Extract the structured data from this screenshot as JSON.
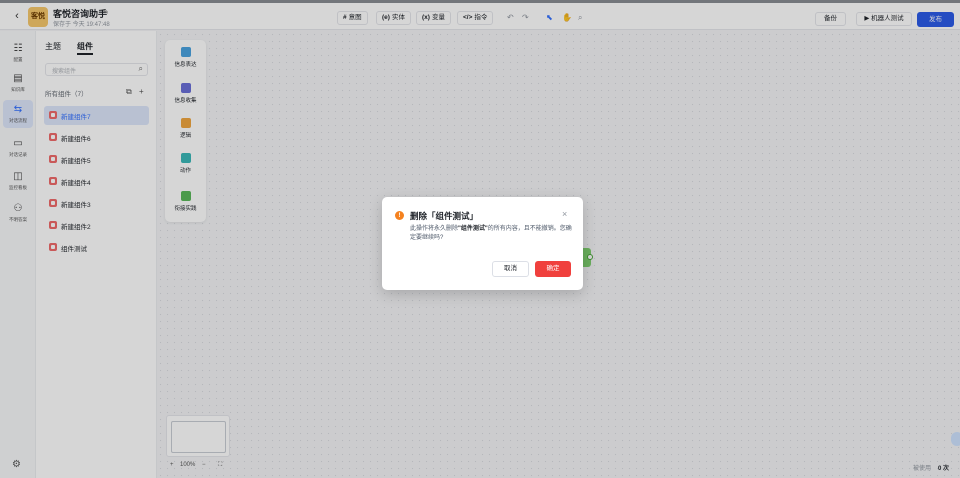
{
  "header": {
    "back_icon": "chevron-left-icon",
    "logo_text": "客悦",
    "title": "客悦咨询助手",
    "save_status": "保存于 今天 19:47:48",
    "tools": [
      {
        "icon": "#",
        "label": "意图"
      },
      {
        "icon": "(e)",
        "label": "实体"
      },
      {
        "icon": "(x)",
        "label": "变量"
      },
      {
        "icon": "</>",
        "label": "指令"
      }
    ],
    "backup_label": "备份",
    "robot_test_label": "▶ 机器人测试",
    "publish_label": "发布"
  },
  "nav": {
    "items": [
      {
        "icon": "☷",
        "label": "配置"
      },
      {
        "icon": "▤",
        "label": "知识库"
      },
      {
        "icon": "⇆",
        "label": "对话流程"
      },
      {
        "icon": "▭",
        "label": "对话记录"
      },
      {
        "icon": "◫",
        "label": "监控看板"
      },
      {
        "icon": "⚇",
        "label": "不明答案"
      }
    ],
    "active_index": 2
  },
  "panel": {
    "tabs": [
      "主题",
      "组件"
    ],
    "active_tab": 1,
    "search_placeholder": "搜索组件",
    "section_title": "所有组件（7）",
    "components": [
      "新建组件7",
      "新建组件6",
      "新建组件5",
      "新建组件4",
      "新建组件3",
      "新建组件2",
      "组件测试"
    ],
    "active_component": 0
  },
  "palette": {
    "items": [
      {
        "label": "信息表达",
        "color": "#4aa3df"
      },
      {
        "label": "信息收集",
        "color": "#6b6fd8"
      },
      {
        "label": "逻辑",
        "color": "#f0a640"
      },
      {
        "label": "动作",
        "color": "#3bb8b8"
      },
      {
        "label": "衔接实践",
        "color": "#5ab85a"
      }
    ]
  },
  "zoom": {
    "level": "100%"
  },
  "usage": {
    "label": "被使用",
    "count": "0 次"
  },
  "dialog": {
    "title": "删除「组件测试」",
    "body_prefix": "此操作将永久删除",
    "body_bold": "\"组件测试\"",
    "body_suffix": "的所有内容，且不能撤销。您确定要继续吗?",
    "cancel_label": "取消",
    "confirm_label": "确定",
    "confirm_color": "#f0403d"
  }
}
